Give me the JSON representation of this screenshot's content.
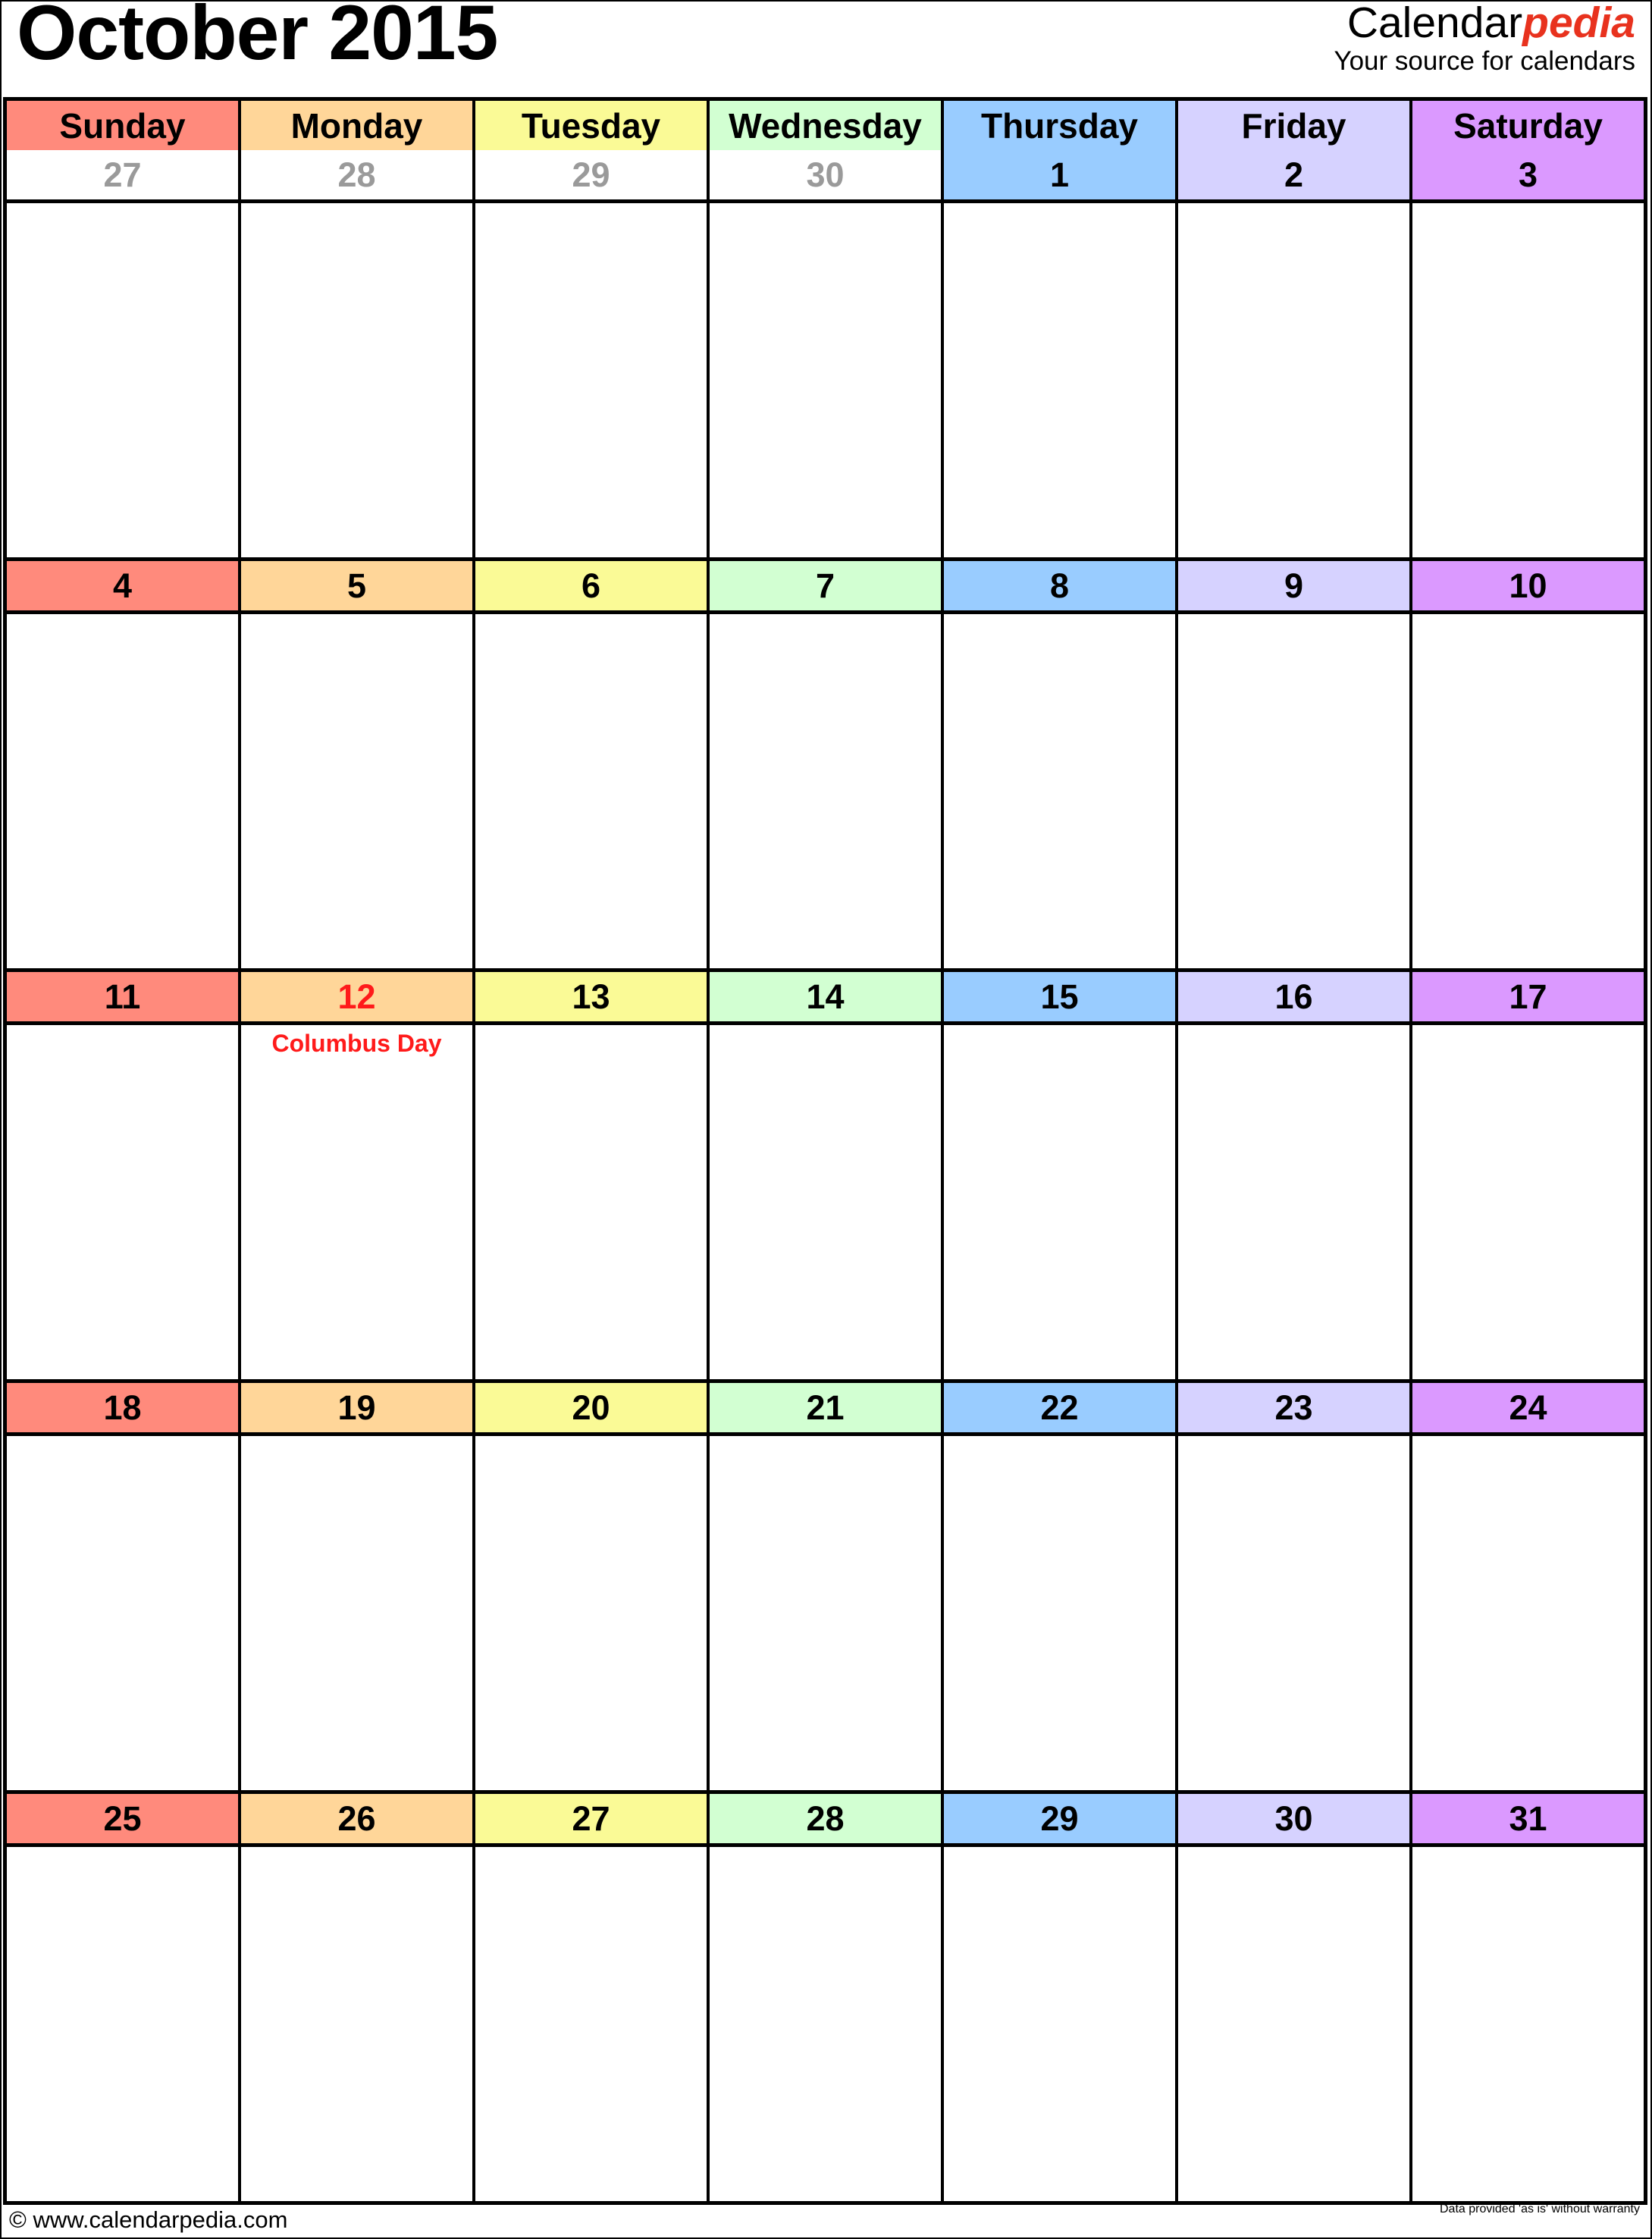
{
  "title": "October 2015",
  "logo": {
    "brand_main": "Calendar",
    "brand_accent": "pedia",
    "tagline": "Your source for calendars",
    "accent_color": "#e8321e"
  },
  "weekdays": [
    {
      "label": "Sunday",
      "color": "#ff8a7c"
    },
    {
      "label": "Monday",
      "color": "#ffd699"
    },
    {
      "label": "Tuesday",
      "color": "#fafa96"
    },
    {
      "label": "Wednesday",
      "color": "#d2ffd2"
    },
    {
      "label": "Thursday",
      "color": "#99ccff"
    },
    {
      "label": "Friday",
      "color": "#d6d2ff"
    },
    {
      "label": "Saturday",
      "color": "#db99ff"
    }
  ],
  "weeks": [
    {
      "days": [
        {
          "num": "27",
          "other": true
        },
        {
          "num": "28",
          "other": true
        },
        {
          "num": "29",
          "other": true
        },
        {
          "num": "30",
          "other": true
        },
        {
          "num": "1"
        },
        {
          "num": "2"
        },
        {
          "num": "3"
        }
      ]
    },
    {
      "days": [
        {
          "num": "4"
        },
        {
          "num": "5"
        },
        {
          "num": "6"
        },
        {
          "num": "7"
        },
        {
          "num": "8"
        },
        {
          "num": "9"
        },
        {
          "num": "10"
        }
      ]
    },
    {
      "days": [
        {
          "num": "11"
        },
        {
          "num": "12",
          "holiday": "Columbus Day"
        },
        {
          "num": "13"
        },
        {
          "num": "14"
        },
        {
          "num": "15"
        },
        {
          "num": "16"
        },
        {
          "num": "17"
        }
      ]
    },
    {
      "days": [
        {
          "num": "18"
        },
        {
          "num": "19"
        },
        {
          "num": "20"
        },
        {
          "num": "21"
        },
        {
          "num": "22"
        },
        {
          "num": "23"
        },
        {
          "num": "24"
        }
      ]
    },
    {
      "days": [
        {
          "num": "25"
        },
        {
          "num": "26"
        },
        {
          "num": "27"
        },
        {
          "num": "28"
        },
        {
          "num": "29"
        },
        {
          "num": "30"
        },
        {
          "num": "31"
        }
      ]
    }
  ],
  "holiday_color": "#ff1a1a",
  "other_month_color": "#9a9a9a",
  "footer": {
    "copyright": "© www.calendarpedia.com",
    "disclaimer": "Data provided 'as is' without warranty"
  }
}
